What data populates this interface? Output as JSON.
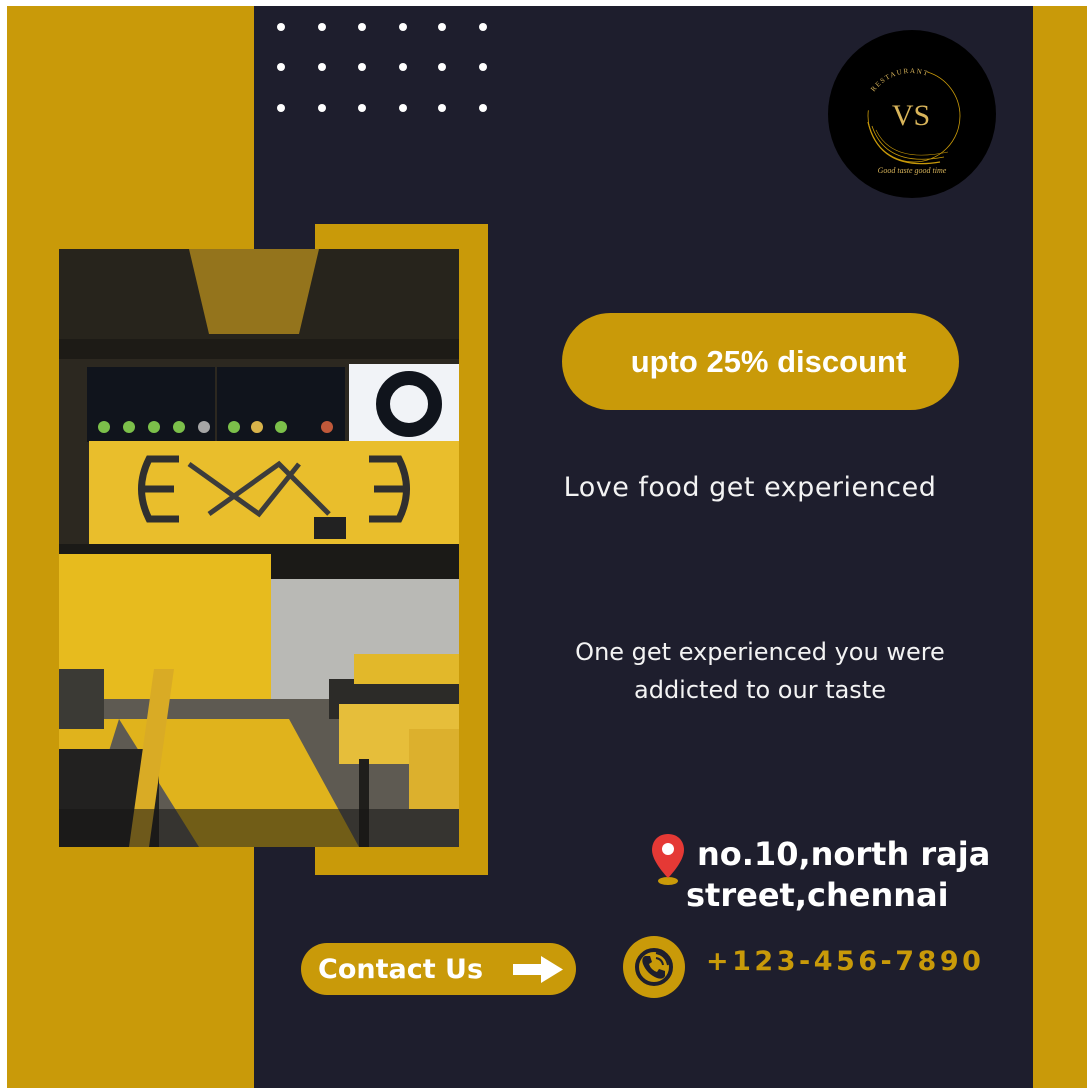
{
  "brand": {
    "logo_initials": "VS",
    "logo_top_text": "RESTAURANT",
    "logo_slogan": "Good taste good time"
  },
  "promo": {
    "discount_label": "upto 25% discount",
    "tagline": "Love food get experienced",
    "description_line1": "One get experienced you were",
    "description_line2": "addicted to our taste"
  },
  "contact": {
    "address_line1": "no.10,north raja",
    "address_line2": "street,chennai",
    "button_label": "Contact Us",
    "phone": "+123-456-7890"
  },
  "icons": [
    "location-pin-icon",
    "arrow-right-icon",
    "phone-icon"
  ],
  "colors": {
    "gold": "#c99a09",
    "navy": "#1e1e2d",
    "white": "#ffffff",
    "pin_red": "#e53935"
  }
}
